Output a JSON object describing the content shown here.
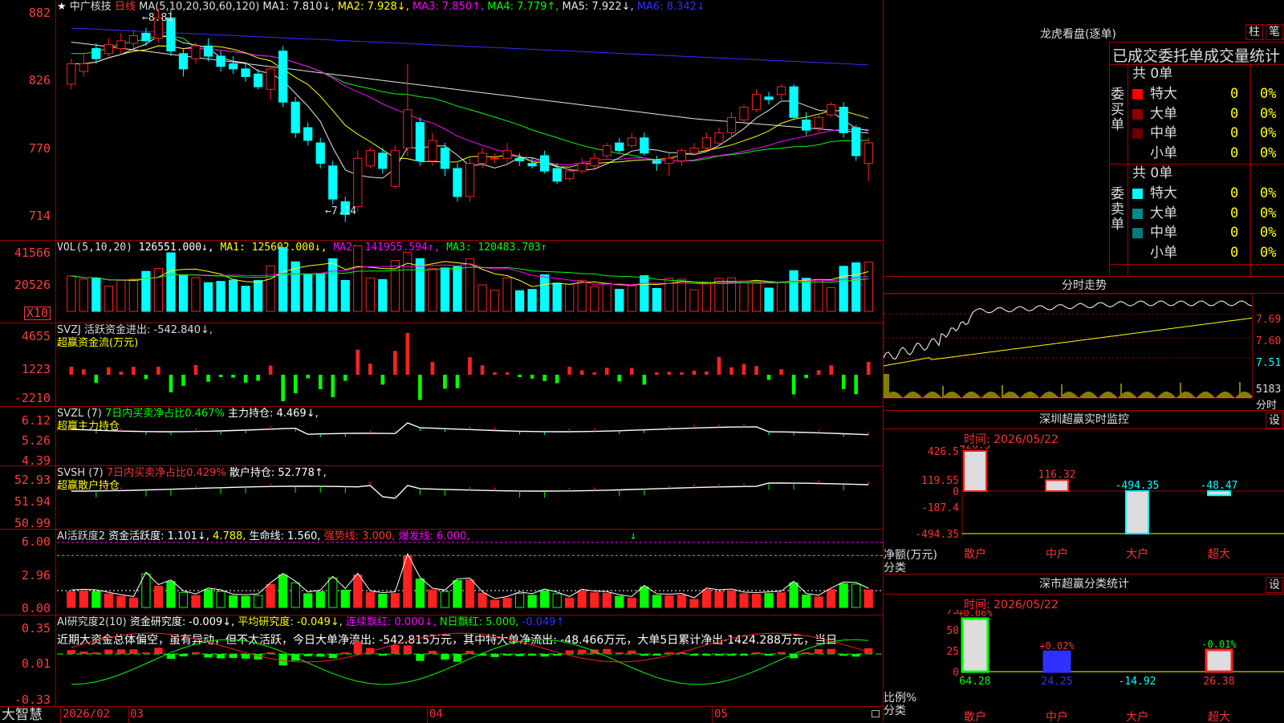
{
  "colors": {
    "up": "#ff2020",
    "down": "#00ffff",
    "green": "#00ff00",
    "yellow": "#ffff00",
    "magenta": "#ff00ff",
    "blue": "#3030ff",
    "white": "#e6e6e6",
    "grid": "#a00000"
  },
  "main": {
    "title_prefix": "★",
    "stock_name": "中广核技",
    "period": "日线",
    "ma_spec": "MA(5,10,20,30,60,120)",
    "ma_values": [
      {
        "label": "MA1: 7.810↓,",
        "color": "#e6e6e6"
      },
      {
        "label": "MA2: 7.928↓,",
        "color": "#ffff00"
      },
      {
        "label": "MA3: 7.850↑,",
        "color": "#ff00ff"
      },
      {
        "label": "MA4: 7.779↑,",
        "color": "#00ff00"
      },
      {
        "label": "MA5: 7.922↓,",
        "color": "#e6e6e6"
      },
      {
        "label": "MA6: 8.342↓",
        "color": "#3030ff"
      }
    ],
    "y_ticks": [
      "882",
      "826",
      "770",
      "714"
    ],
    "high_marker": "←8.81",
    "low_marker": "←7.14"
  },
  "chart_data": [
    {
      "type": "candlestick",
      "title": "中广核技 日线",
      "ylim": [
        700,
        885
      ],
      "note": "prices shown ×100 on axis",
      "x_ticks": [
        "2026/02",
        "03",
        "04",
        "05"
      ],
      "candles": [
        [
          8.22,
          8.38,
          8.42,
          8.18
        ],
        [
          8.32,
          8.38,
          8.46,
          8.28
        ],
        [
          8.5,
          8.42,
          8.54,
          8.38
        ],
        [
          8.46,
          8.53,
          8.58,
          8.44
        ],
        [
          8.5,
          8.56,
          8.62,
          8.46
        ],
        [
          8.54,
          8.6,
          8.64,
          8.5
        ],
        [
          8.62,
          8.56,
          8.66,
          8.52
        ],
        [
          8.58,
          8.74,
          8.81,
          8.55
        ],
        [
          8.74,
          8.48,
          8.81,
          8.44
        ],
        [
          8.46,
          8.34,
          8.5,
          8.28
        ],
        [
          8.42,
          8.52,
          8.55,
          8.38
        ],
        [
          8.52,
          8.44,
          8.58,
          8.4
        ],
        [
          8.44,
          8.36,
          8.48,
          8.32
        ],
        [
          8.38,
          8.34,
          8.44,
          8.3
        ],
        [
          8.34,
          8.28,
          8.38,
          8.24
        ],
        [
          8.3,
          8.2,
          8.34,
          8.18
        ],
        [
          8.18,
          8.34,
          8.36,
          8.1
        ],
        [
          8.48,
          8.08,
          8.52,
          8.04
        ],
        [
          8.08,
          7.84,
          8.12,
          7.8
        ],
        [
          7.88,
          7.78,
          7.92,
          7.74
        ],
        [
          7.76,
          7.6,
          7.8,
          7.56
        ],
        [
          7.58,
          7.32,
          7.62,
          7.28
        ],
        [
          7.3,
          7.2,
          7.34,
          7.14
        ],
        [
          7.26,
          7.64,
          7.7,
          7.22
        ],
        [
          7.58,
          7.7,
          7.72,
          7.56
        ],
        [
          7.68,
          7.56,
          7.72,
          7.52
        ],
        [
          7.42,
          7.7,
          7.74,
          7.4
        ],
        [
          7.72,
          8.02,
          8.38,
          7.66
        ],
        [
          7.92,
          7.62,
          7.96,
          7.58
        ],
        [
          7.62,
          7.78,
          7.84,
          7.58
        ],
        [
          7.72,
          7.56,
          7.76,
          7.5
        ],
        [
          7.56,
          7.34,
          7.6,
          7.3
        ],
        [
          7.34,
          7.6,
          7.64,
          7.3
        ],
        [
          7.6,
          7.68,
          7.72,
          7.56
        ],
        [
          7.64,
          7.64,
          7.68,
          7.6
        ],
        [
          7.64,
          7.7,
          7.76,
          7.6
        ],
        [
          7.64,
          7.62,
          7.68,
          7.58
        ],
        [
          7.6,
          7.58,
          7.64,
          7.56
        ],
        [
          7.66,
          7.54,
          7.7,
          7.52
        ],
        [
          7.56,
          7.46,
          7.6,
          7.44
        ],
        [
          7.48,
          7.54,
          7.58,
          7.46
        ],
        [
          7.54,
          7.6,
          7.64,
          7.52
        ],
        [
          7.58,
          7.64,
          7.68,
          7.56
        ],
        [
          7.66,
          7.74,
          7.76,
          7.64
        ],
        [
          7.76,
          7.7,
          7.8,
          7.68
        ],
        [
          7.74,
          7.8,
          7.84,
          7.72
        ],
        [
          7.8,
          7.68,
          7.84,
          7.66
        ],
        [
          7.62,
          7.6,
          7.66,
          7.54
        ],
        [
          7.6,
          7.64,
          7.68,
          7.5
        ],
        [
          7.62,
          7.7,
          7.72,
          7.58
        ],
        [
          7.68,
          7.72,
          7.76,
          7.66
        ],
        [
          7.72,
          7.8,
          7.84,
          7.7
        ],
        [
          7.76,
          7.84,
          7.88,
          7.74
        ],
        [
          7.84,
          7.96,
          8.0,
          7.8
        ],
        [
          7.94,
          8.04,
          8.06,
          7.92
        ],
        [
          8.02,
          8.14,
          8.18,
          8.0
        ],
        [
          8.12,
          8.1,
          8.16,
          8.06
        ],
        [
          8.14,
          8.2,
          8.22,
          8.1
        ],
        [
          8.2,
          7.96,
          8.22,
          7.94
        ],
        [
          7.94,
          7.86,
          8.0,
          7.82
        ],
        [
          7.88,
          7.96,
          7.98,
          7.84
        ],
        [
          7.98,
          8.06,
          8.08,
          7.96
        ],
        [
          8.04,
          7.84,
          8.08,
          7.8
        ],
        [
          7.88,
          7.66,
          7.9,
          7.62
        ],
        [
          7.6,
          7.76,
          7.8,
          7.46
        ]
      ]
    },
    {
      "type": "bar",
      "title": "VOL(5,10,20)",
      "legend": [
        "126551.000↓,",
        "MA1: 125602.000↓,",
        "MA2: 141955.594↑,",
        "MA3: 120483.703↑"
      ],
      "y_ticks": [
        "41566",
        "20526",
        "X10"
      ]
    },
    {
      "type": "bar",
      "title": "SVZJ 活跃资金进出",
      "value": "-542.840",
      "unit": "万元",
      "y_ticks": [
        "4655",
        "1223",
        "-2210"
      ]
    },
    {
      "type": "line",
      "title": "SVZL (7)",
      "y_ticks": [
        "6.12",
        "5.26",
        "4.39"
      ]
    },
    {
      "type": "line",
      "title": "SVSH (7)",
      "y_ticks": [
        "52.93",
        "51.94",
        "50.99"
      ]
    },
    {
      "type": "bar",
      "title": "AI活跃度2",
      "y_ticks": [
        "6.00",
        "2.96",
        "0.00"
      ]
    },
    {
      "type": "bar",
      "title": "AI研究度2(10)",
      "y_ticks": [
        "0.35",
        "0.01",
        "-0.33"
      ]
    },
    {
      "type": "bar",
      "title": "深圳超赢实时监控",
      "categories": [
        "散户",
        "中户",
        "大户",
        "超大"
      ],
      "values": [
        426.5,
        116.32,
        -494.35,
        -48.47
      ],
      "ylim": [
        -494.35,
        426.5
      ],
      "y_ticks": [
        "426.5",
        "119.55",
        "0",
        "-187.4",
        "-494.35"
      ],
      "ylabel": "净额(万元)",
      "xlabel": "分类"
    },
    {
      "type": "bar",
      "title": "深市超赢分类统计",
      "categories": [
        "散户",
        "中户",
        "大户",
        "超大"
      ],
      "values": [
        64.28,
        24.25,
        -14.92,
        26.38
      ],
      "top_labels": [
        "+0.06%",
        "+0.02%",
        "",
        "-0.01%"
      ],
      "ylim": [
        0,
        75
      ],
      "y_ticks": [
        "75",
        "50",
        "25",
        "0"
      ],
      "ylabel": "比例%",
      "xlabel": "分类"
    }
  ],
  "volume": {
    "title": "VOL(5,10,20)",
    "v": "126551.000↓,",
    "ma1": "MA1: 125602.000↓,",
    "ma2": "MA2: 141955.594↑,",
    "ma3": "MA3: 120483.703↑",
    "y_ticks": [
      "41566",
      "20526",
      "X10"
    ]
  },
  "svzj": {
    "title": "SVZJ 活跃资金进出: -542.840↓,",
    "subtitle": "超赢资金流(万元)",
    "y_ticks": [
      "4655",
      "1223",
      "-2210"
    ]
  },
  "svzl": {
    "title": "SVZL (7)",
    "ratio": "7日内买卖净占比0.467%",
    "pos": "主力持仓: 4.469↓,",
    "subtitle": "超赢主力持仓",
    "y_ticks": [
      "6.12",
      "5.26",
      "4.39"
    ]
  },
  "svsh": {
    "title": "SVSH (7)",
    "ratio": "7日内买卖净占比0.429%",
    "pos": "散户持仓: 52.778↑,",
    "subtitle": "超赢散户持仓",
    "y_ticks": [
      "52.93",
      "51.94",
      "50.99"
    ]
  },
  "ai_active": {
    "title": "AI活跃度2",
    "v1": "资金活跃度: 1.101↓,",
    "v2": "4.788,",
    "v3": "生命线: 1.560,",
    "v4": "强势线: 3.000,",
    "v5": "爆发线: 6.000,",
    "arrow": "↓",
    "y_ticks": [
      "6.00",
      "2.96",
      "0.00"
    ]
  },
  "ai_research": {
    "title": "AI研究度2(10)",
    "v1": "资金研究度: -0.009↓,",
    "v2": "平均研究度: -0.049↓,",
    "v3": "连续飘红: 0.000↓,",
    "v4": "N日飘红: 5.000,",
    "v5": "-0.049↑",
    "comment": "近期大资金总体偏空，虽有异动，但不太活跃，今日大单净流出: -542.815万元，其中特大单净流出: -48.466万元，大单5日累计净出-1424.288万元，当日",
    "y_ticks": [
      "0.35",
      "0.01",
      "-0.33"
    ]
  },
  "bottom": {
    "brand": "大智慧",
    "dates": [
      "2026/02",
      "03",
      "04",
      "05"
    ]
  },
  "right": {
    "lhb_title": "龙虎看盘(逐单)",
    "btn_zhu": "柱",
    "btn_bi": "笔",
    "table_title": "已成交委托单成交量统计",
    "buy_group": "委买单",
    "sell_group": "委卖单",
    "buy_total": "共 0单",
    "sell_total": "共 0单",
    "buy_rows": [
      {
        "name": "特大",
        "n": "0",
        "p": "0%",
        "c": "#ff0000"
      },
      {
        "name": "大单",
        "n": "0",
        "p": "0%",
        "c": "#8b0000"
      },
      {
        "name": "中单",
        "n": "0",
        "p": "0%",
        "c": "#6b0000"
      },
      {
        "name": "小单",
        "n": "0",
        "p": "0%",
        "c": "#000000"
      }
    ],
    "sell_rows": [
      {
        "name": "特大",
        "n": "0",
        "p": "0%",
        "c": "#00ffff"
      },
      {
        "name": "大单",
        "n": "0",
        "p": "0%",
        "c": "#008b8b"
      },
      {
        "name": "中单",
        "n": "0",
        "p": "0%",
        "c": "#007b7b"
      },
      {
        "name": "小单",
        "n": "0",
        "p": "0%",
        "c": "#000000"
      }
    ],
    "intraday_title": "分时走势",
    "intraday_ticks": [
      "7.69",
      "7.60",
      "7.51",
      "5183",
      "分时"
    ],
    "sz_title": "深圳超赢实时监控",
    "sz_time": "时间: 2026/05/22",
    "settings": "设",
    "sz_vals": [
      "426.5",
      "116.32",
      "-494.35",
      "-48.47"
    ],
    "sz_ticks": [
      "426.5",
      "119.55",
      "0",
      "-187.4",
      "-494.35"
    ],
    "sz_ylabel": "净额(万元)",
    "sz_xlabel": "分类",
    "cats": [
      "散户",
      "中户",
      "大户",
      "超大"
    ],
    "ss_title": "深市超赢分类统计",
    "ss_time": "时间: 2026/05/22",
    "ss_top": [
      "+0.06%",
      "+0.02%",
      "-0.01%"
    ],
    "ss_vals": [
      "64.28",
      "24.25",
      "-14.92",
      "26.38"
    ],
    "ss_ticks": [
      "75",
      "50",
      "25",
      "0"
    ],
    "ss_ylabel": "比例%",
    "ss_xlabel": "分类"
  }
}
